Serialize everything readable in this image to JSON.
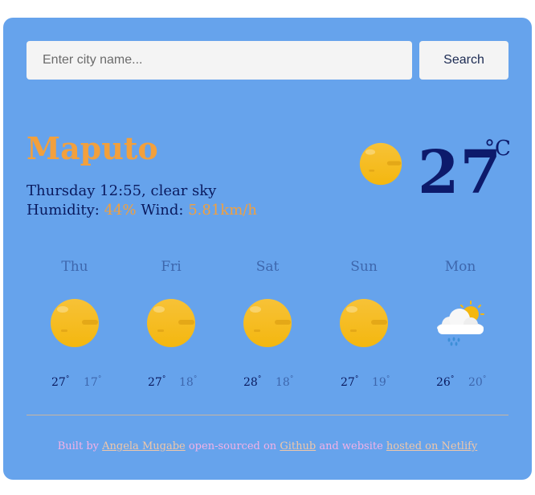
{
  "search": {
    "placeholder": "Enter city name...",
    "button_label": "Search"
  },
  "current": {
    "city": "Maputo",
    "description": "Thursday 12:55, clear sky",
    "humidity_label": "Humidity:",
    "humidity_value": "44%",
    "wind_label": "Wind:",
    "wind_value": "5.81km/h",
    "temperature": "27",
    "unit": "°C",
    "icon": "sun-icon"
  },
  "forecast": [
    {
      "day": "Thu",
      "max": "27",
      "min": "17",
      "icon": "sun-icon"
    },
    {
      "day": "Fri",
      "max": "27",
      "min": "18",
      "icon": "sun-icon"
    },
    {
      "day": "Sat",
      "max": "28",
      "min": "18",
      "icon": "sun-icon"
    },
    {
      "day": "Sun",
      "max": "27",
      "min": "19",
      "icon": "sun-icon"
    },
    {
      "day": "Mon",
      "max": "26",
      "min": "20",
      "icon": "rain-cloud-icon"
    }
  ],
  "degree_symbol": "°",
  "footer": {
    "built_by": "Built by",
    "author": "Angela Mugabe",
    "open_sourced_on": "open-sourced on",
    "github": "Github",
    "and_website": "and website",
    "hosted_on": "hosted on Netlify"
  },
  "colors": {
    "card_bg": "#66a3ec",
    "accent": "#f2a03d",
    "primary_text": "#0a1a5e",
    "muted_text": "#3e67ad"
  }
}
